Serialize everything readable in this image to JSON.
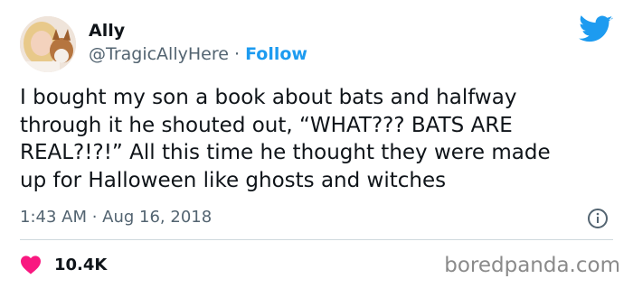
{
  "author": {
    "name": "Ally",
    "handle": "@TragicAllyHere",
    "separator": "·",
    "follow_label": "Follow"
  },
  "tweet": {
    "text": "I bought my son a book about bats and halfway\nthrough it he shouted out, “WHAT??? BATS ARE\nREAL?!?!” All this time he thought they were made\nup for Halloween like ghosts and witches",
    "timestamp": "1:43 AM · Aug 16, 2018"
  },
  "engagement": {
    "likes": "10.4K"
  },
  "watermark": "boredpanda.com",
  "icons": {
    "brand": "twitter-bird-icon",
    "info": "info-icon",
    "like": "heart-icon"
  },
  "colors": {
    "accent": "#1d9bf0",
    "heart": "#f91880",
    "secondary_text": "#536471",
    "divider": "#cfd9de"
  }
}
